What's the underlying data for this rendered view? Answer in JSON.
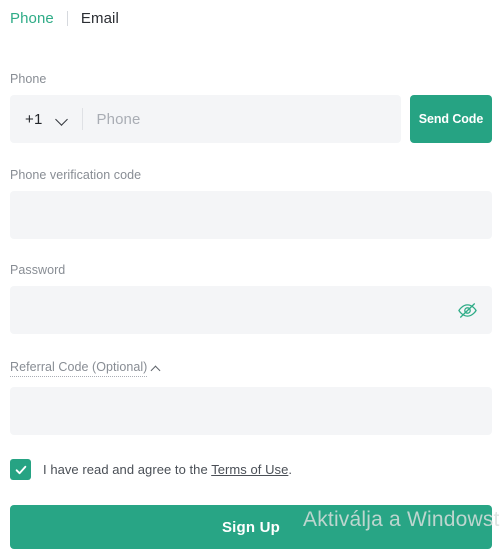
{
  "tabs": {
    "phone_label": "Phone",
    "email_label": "Email"
  },
  "phone_field": {
    "label": "Phone",
    "country_code": "+1",
    "placeholder": "Phone",
    "value": "",
    "send_code_label": "Send Code"
  },
  "verification_field": {
    "label": "Phone verification code",
    "placeholder": "",
    "value": ""
  },
  "password_field": {
    "label": "Password",
    "placeholder": "",
    "value": ""
  },
  "referral_field": {
    "toggle_label": "Referral Code (Optional)",
    "placeholder": "",
    "value": ""
  },
  "agreement": {
    "checked": true,
    "text_before": "I have read and agree to the",
    "link_label": "Terms of Use",
    "text_after": "."
  },
  "submit": {
    "label": "Sign Up"
  },
  "watermark": {
    "text": "Aktiválja a Windowst"
  },
  "colors": {
    "accent": "#26a383",
    "tab_active": "#2fac87",
    "tab_inactive": "#2b2e33",
    "label": "#888d94",
    "input_bg": "#f4f5f7",
    "placeholder": "#a9adb4"
  }
}
